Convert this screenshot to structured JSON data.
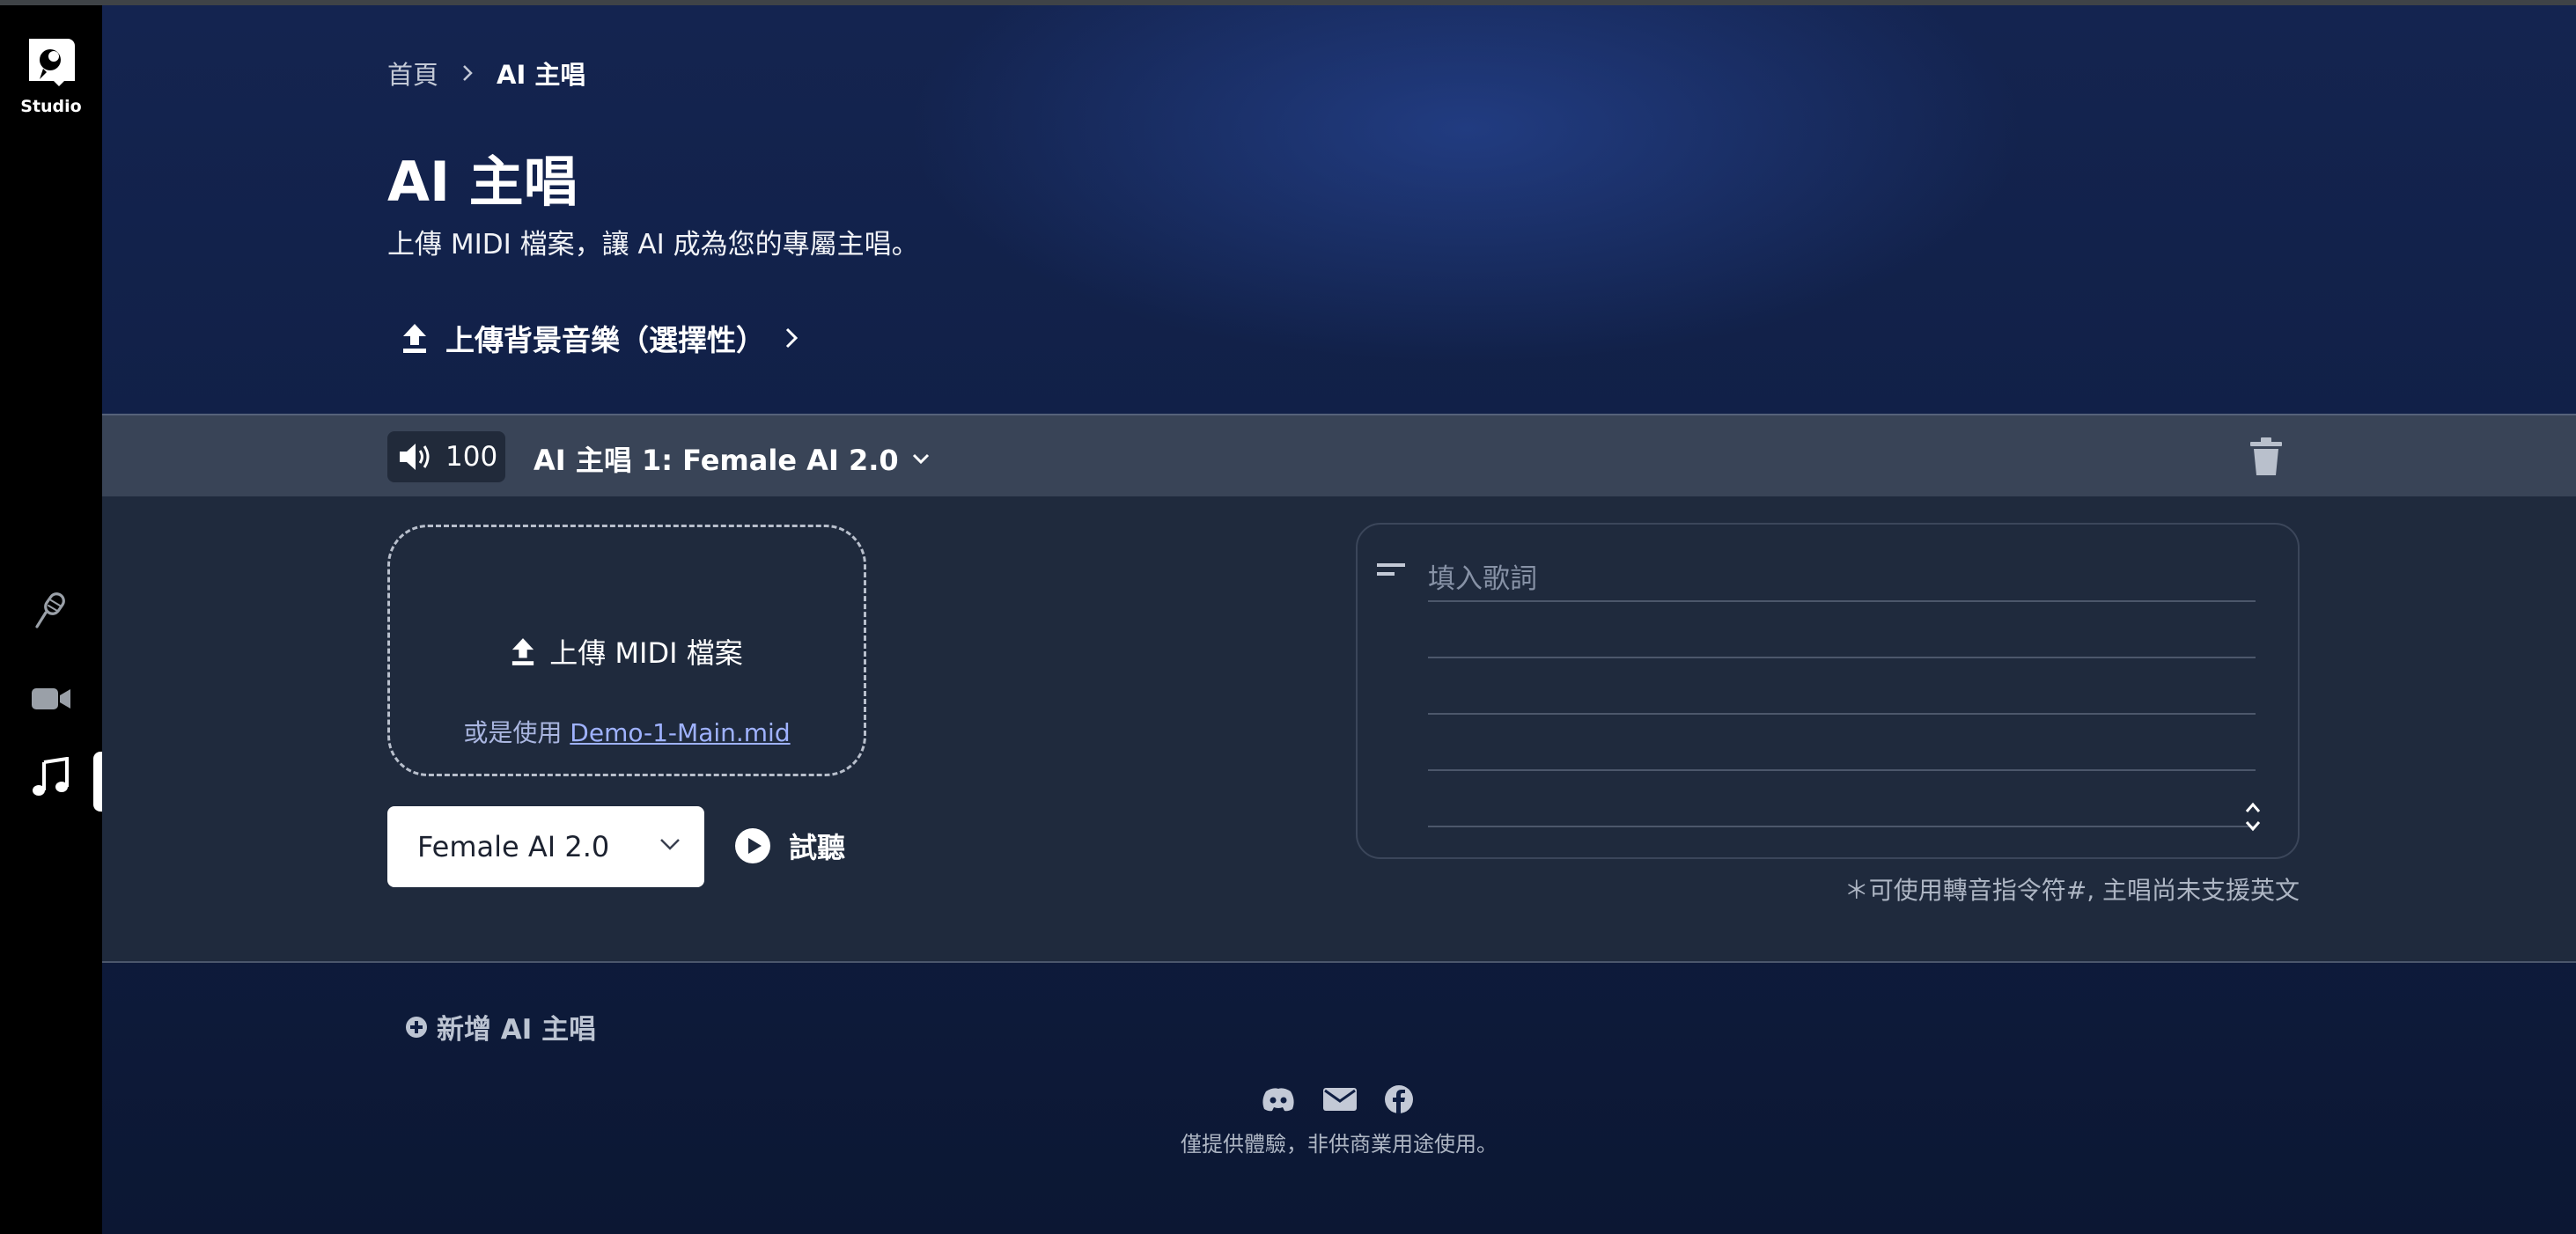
{
  "sidebar": {
    "logo_text": "Studio",
    "items": [
      {
        "icon": "microphone-icon"
      },
      {
        "icon": "video-camera-icon"
      },
      {
        "icon": "music-note-icon",
        "active": true
      }
    ]
  },
  "breadcrumb": {
    "home": "首頁",
    "current": "AI 主唱"
  },
  "header": {
    "title": "AI 主唱",
    "subtitle": "上傳 MIDI 檔案，讓 AI 成為您的專屬主唱。",
    "bg_upload_label": "上傳背景音樂（選擇性）"
  },
  "track": {
    "volume": "100",
    "title": "AI 主唱 1: Female AI 2.0",
    "upload_midi_label": "上傳 MIDI 檔案",
    "or_use_label": "或是使用",
    "demo_file": "Demo-1-Main.mid",
    "voice_selected": "Female AI 2.0",
    "preview_label": "試聽",
    "lyrics_placeholder": "填入歌詞",
    "lyrics_note": "＊可使用轉音指令符#, 主唱尚未支援英文"
  },
  "add_singer_label": "新增 AI 主唱",
  "footer": {
    "icons": [
      "discord-icon",
      "mail-icon",
      "facebook-icon"
    ],
    "text": "僅提供體驗，非供商業用途使用。"
  },
  "colors": {
    "accent_link": "#9fb2ff",
    "track_header": "#394457",
    "track_body": "#1f2a3d"
  }
}
